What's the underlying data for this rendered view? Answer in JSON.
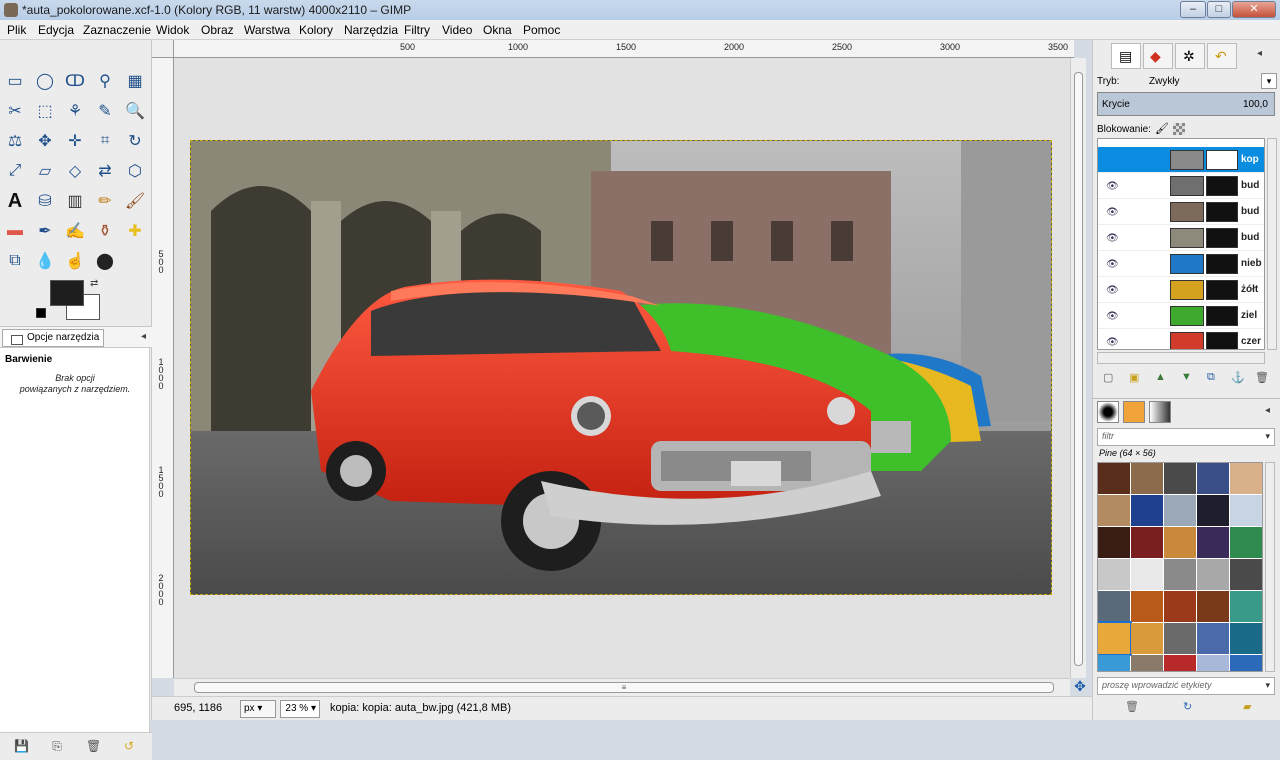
{
  "window": {
    "title": "*auta_pokolorowane.xcf-1.0 (Kolory RGB, 11 warstw) 4000x2110 – GIMP",
    "controls": [
      "–",
      "□",
      "✕"
    ]
  },
  "menu": [
    "Plik",
    "Edycja",
    "Zaznaczenie",
    "Widok",
    "Obraz",
    "Warstwa",
    "Kolory",
    "Narzędzia",
    "Filtry",
    "Video",
    "Okna",
    "Pomoc"
  ],
  "tool_options": {
    "tab_label": "Opcje narzędzia",
    "tool_name": "Barwienie",
    "message_line1": "Brak opcji",
    "message_line2": "powiązanych z narzędziem."
  },
  "ruler": {
    "h_ticks": [
      "500",
      "1000",
      "1500",
      "2000",
      "2500",
      "3000",
      "3500"
    ],
    "v_ticks": [
      "500",
      "1000",
      "1500",
      "2000"
    ]
  },
  "status": {
    "coords": "695, 1186",
    "unit": "px",
    "zoom": "23 %",
    "message": "kopia: kopia: auta_bw.jpg (421,8 MB)"
  },
  "layers_dock": {
    "mode_label": "Tryb:",
    "mode_value": "Zwykły",
    "opacity_label": "Krycie",
    "opacity_value": "100,0",
    "lock_label": "Blokowanie:",
    "layers": [
      {
        "name": "kop",
        "color": "#8a8a8a",
        "visible": false,
        "selected": true
      },
      {
        "name": "bud",
        "color": "#6f6f6f",
        "visible": true,
        "selected": false
      },
      {
        "name": "bud",
        "color": "#7c6a5a",
        "visible": true,
        "selected": false
      },
      {
        "name": "bud",
        "color": "#8d8a7c",
        "visible": true,
        "selected": false
      },
      {
        "name": "nieb",
        "color": "#1f78c8",
        "visible": true,
        "selected": false
      },
      {
        "name": "żółt",
        "color": "#d4a21f",
        "visible": true,
        "selected": false
      },
      {
        "name": "ziel",
        "color": "#3fa82e",
        "visible": true,
        "selected": false
      },
      {
        "name": "czer",
        "color": "#d23a2a",
        "visible": true,
        "selected": false
      }
    ]
  },
  "patterns_dock": {
    "filter_placeholder": "filtr",
    "pattern_name": "Pine (64 × 56)",
    "tag_placeholder": "proszę wprowadzić etykiety",
    "swatches": [
      "#5a2e1a",
      "#8c6a4c",
      "#4a4a4a",
      "#3a4f88",
      "#d8b08a",
      "#b48a60",
      "#1f3f8f",
      "#9aa8b8",
      "#1e1e2e",
      "#c8d4e4",
      "#3a1e14",
      "#7a1f1f",
      "#c88a3a",
      "#3a2a5a",
      "#2e8a4e",
      "#c8c8c8",
      "#e8e8e8",
      "#8a8a8a",
      "#a8a8a8",
      "#4a4a4a",
      "#5a6a7a",
      "#b85a1a",
      "#9a3a1a",
      "#7a3a1a",
      "#3a9a8a",
      "#e8a83a",
      "#d89a3a",
      "#6a6a6a",
      "#4a6aaa",
      "#1a6a8a",
      "#3a9ad8",
      "#8a7a6a",
      "#b82a2a",
      "#a8b8d8",
      "#2a6ab8"
    ]
  }
}
